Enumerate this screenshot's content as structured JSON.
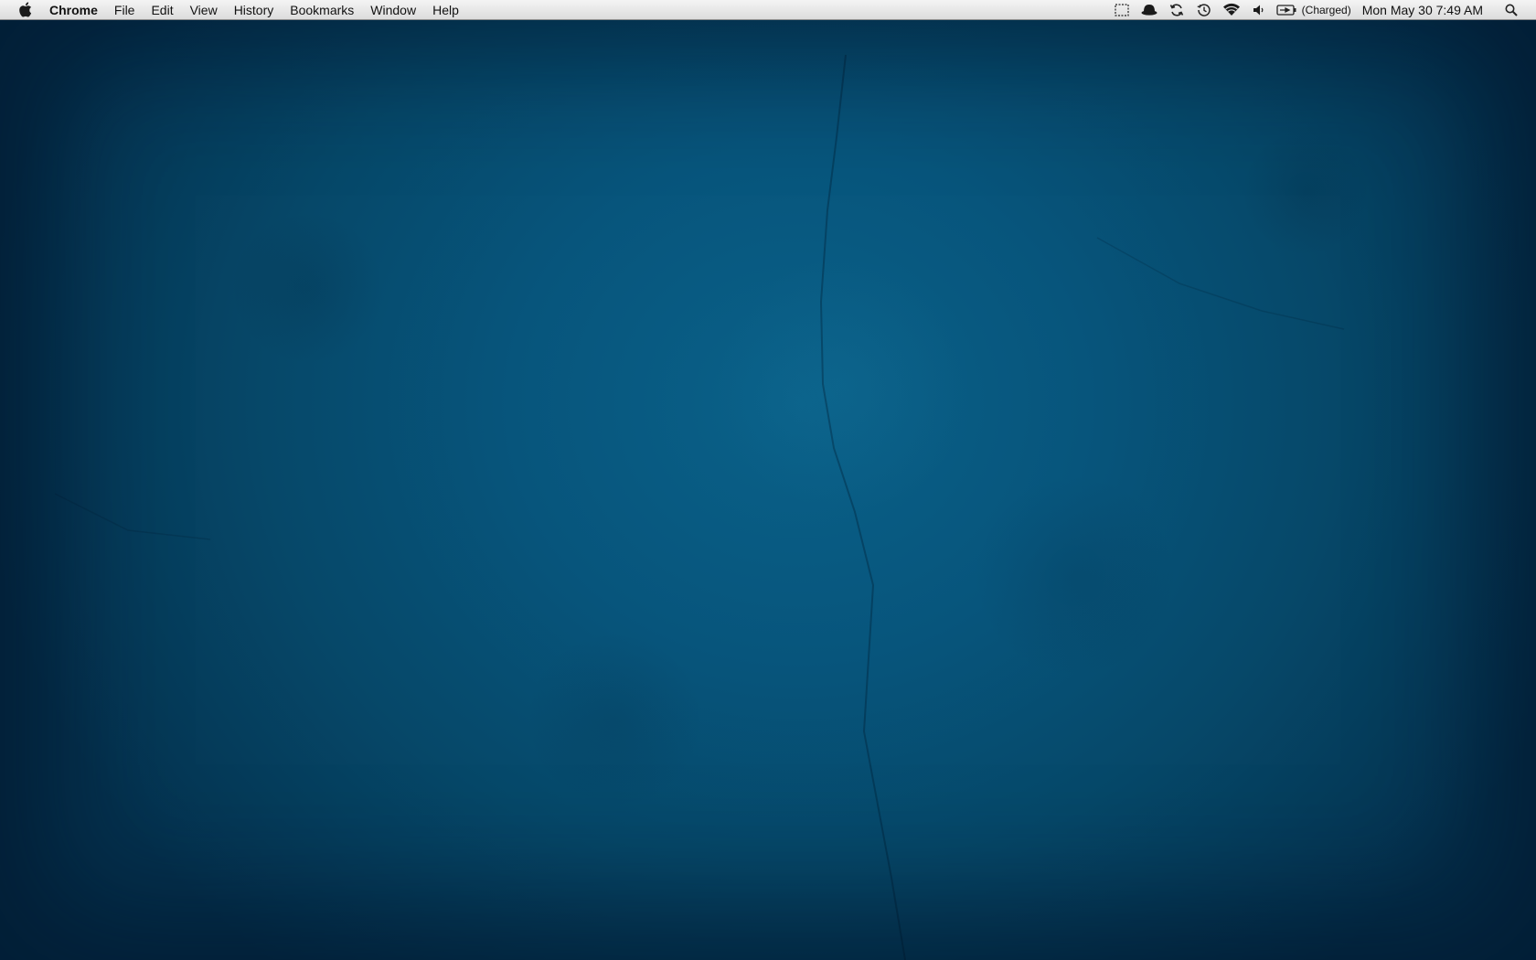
{
  "menubar": {
    "apple_icon": "apple-logo-icon",
    "app_name": "Chrome",
    "menus": [
      "File",
      "Edit",
      "View",
      "History",
      "Bookmarks",
      "Window",
      "Help"
    ],
    "status_icons": [
      "screen-capture-icon",
      "growl-icon",
      "sync-icon",
      "time-machine-icon",
      "wifi-icon",
      "volume-icon",
      "battery-icon"
    ],
    "battery_status": "(Charged)",
    "clock": "Mon May 30  7:49 AM",
    "spotlight_icon": "spotlight-search-icon"
  },
  "desktop": {
    "wallpaper_color": "#07557c"
  }
}
